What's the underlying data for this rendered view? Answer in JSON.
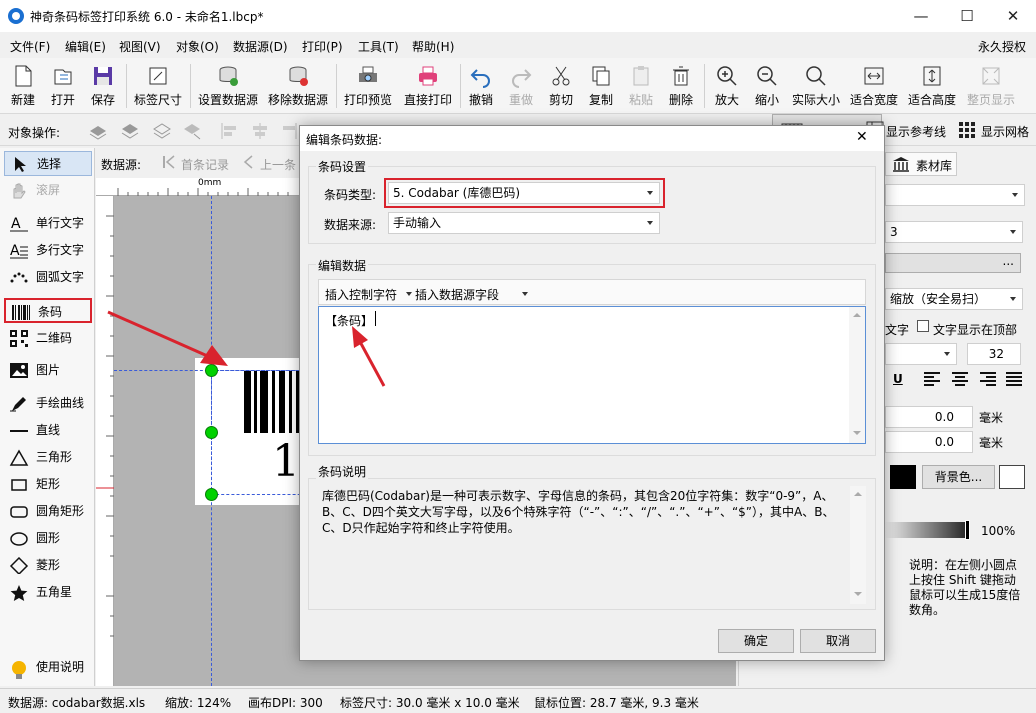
{
  "window": {
    "title": "神奇条码标签打印系统 6.0 - 未命名1.lbcp*",
    "minimize": "—",
    "maximize": "☐",
    "close": "✕"
  },
  "menu": {
    "items": [
      "文件(F)",
      "编辑(E)",
      "视图(V)",
      "对象(O)",
      "数据源(D)",
      "打印(P)",
      "工具(T)",
      "帮助(H)"
    ],
    "license": "永久授权"
  },
  "toolbar": {
    "buttons": [
      {
        "label": "新建",
        "icon": "new-doc-icon"
      },
      {
        "label": "打开",
        "icon": "open-icon"
      },
      {
        "label": "保存",
        "icon": "save-icon"
      },
      {
        "label": "标签尺寸",
        "icon": "label-size-icon"
      },
      {
        "label": "设置数据源",
        "icon": "set-datasource-icon"
      },
      {
        "label": "移除数据源",
        "icon": "remove-datasource-icon"
      },
      {
        "label": "打印预览",
        "icon": "print-preview-icon"
      },
      {
        "label": "直接打印",
        "icon": "printer-icon"
      },
      {
        "label": "撤销",
        "icon": "undo-icon"
      },
      {
        "label": "重做",
        "icon": "redo-icon"
      },
      {
        "label": "剪切",
        "icon": "scissors-icon"
      },
      {
        "label": "复制",
        "icon": "copy-icon"
      },
      {
        "label": "粘贴",
        "icon": "paste-icon"
      },
      {
        "label": "删除",
        "icon": "trash-icon"
      },
      {
        "label": "放大",
        "icon": "zoom-in-icon"
      },
      {
        "label": "缩小",
        "icon": "zoom-out-icon"
      },
      {
        "label": "实际大小",
        "icon": "actual-size-icon"
      },
      {
        "label": "适合宽度",
        "icon": "fit-width-icon"
      },
      {
        "label": "适合高度",
        "icon": "fit-height-icon"
      },
      {
        "label": "整页显示",
        "icon": "full-page-icon"
      }
    ]
  },
  "opsbar": {
    "label": "对象操作:",
    "show_guides": "显示参考线",
    "show_grid": "显示网格"
  },
  "lefttools": {
    "items": [
      "选择",
      "滚屏",
      "单行文字",
      "多行文字",
      "圆弧文字",
      "条码",
      "二维码",
      "图片",
      "手绘曲线",
      "直线",
      "三角形",
      "矩形",
      "圆角矩形",
      "圆形",
      "菱形",
      "五角星"
    ],
    "help": "使用说明"
  },
  "canvas": {
    "datasource_label": "数据源:",
    "first_record": "首条记录",
    "prev_record": "上一条",
    "ruler_zero": "0mm",
    "barcode_digit": "1"
  },
  "rightpanel": {
    "library_tab": "素材库",
    "scale_option": "缩放（安全易扫）",
    "text_label": "文字",
    "text_top_checkbox": "文字显示在顶部",
    "font_size": "32",
    "value1": "0.0",
    "value2": "0.0",
    "unit": "毫米",
    "bg_color_btn": "背景色...",
    "percent": "100%",
    "hint": "说明：在左侧小圆点上按住 Shift 键拖动鼠标可以生成15度倍数角。",
    "underline": "U",
    "small_value": "3",
    "more": "..."
  },
  "status": {
    "datasource": "数据源: codabar数据.xls",
    "zoom": "缩放: 124%",
    "dpi": "画布DPI: 300",
    "label_size": "标签尺寸: 30.0 毫米 x 10.0 毫米",
    "mouse": "鼠标位置: 28.7 毫米, 9.3 毫米"
  },
  "dialog": {
    "title": "编辑条码数据:",
    "close": "✕",
    "barcode_settings": "条码设置",
    "type_label": "条码类型:",
    "type_value": "5. Codabar (库德巴码)",
    "source_label": "数据来源:",
    "source_value": "手动输入",
    "edit_data": "编辑数据",
    "insert_control": "插入控制字符",
    "insert_field": "插入数据源字段",
    "data_text": "【条码】",
    "desc_title": "条码说明",
    "desc_text": "库德巴码(Codabar)是一种可表示数字、字母信息的条码，其包含20位字符集：数字“0-9”，A、B、C、D四个英文大写字母，以及6个特殊字符（“-”、“:”、“/”、“.”、“+”、“$”），其中A、B、C、D只作起始字符和终止字符使用。",
    "ok": "确定",
    "cancel": "取消"
  },
  "colors": {
    "highlight_red": "#d9232d",
    "handle_green": "#00d100",
    "guide_blue": "#3a5bd9"
  }
}
